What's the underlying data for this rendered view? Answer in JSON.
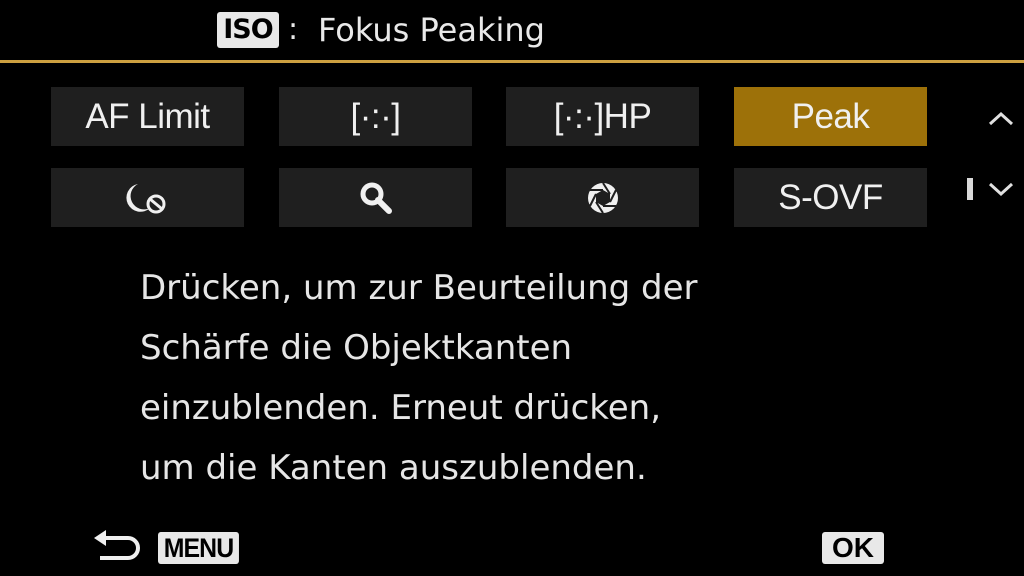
{
  "header": {
    "badge": "ISO",
    "separator": ":",
    "title": "Fokus Peaking",
    "accent_color": "#cda040"
  },
  "buttons": [
    {
      "label": "AF Limit",
      "icon": null,
      "selected": false
    },
    {
      "label": "[·:·]",
      "icon": null,
      "selected": false
    },
    {
      "label": "[·:·]HP",
      "icon": null,
      "selected": false
    },
    {
      "label": "Peak",
      "icon": null,
      "selected": true
    },
    {
      "label": "",
      "icon": "moon-no-icon",
      "selected": false
    },
    {
      "label": "",
      "icon": "magnifier-icon",
      "selected": false
    },
    {
      "label": "",
      "icon": "aperture-icon",
      "selected": false
    },
    {
      "label": "S-OVF",
      "icon": null,
      "selected": false
    }
  ],
  "selected_color": "#9d7109",
  "description": [
    "Drücken, um zur Beurteilung der",
    "Schärfe die Objektkanten",
    "einzublenden. Erneut drücken,",
    "um die Kanten auszublenden."
  ],
  "footer": {
    "back_icon": "return-arrow-icon",
    "menu_label": "MENU",
    "ok_label": "OK"
  },
  "scroll": {
    "up_icon": "chevron-up-icon",
    "down_icon": "chevron-down-icon"
  }
}
